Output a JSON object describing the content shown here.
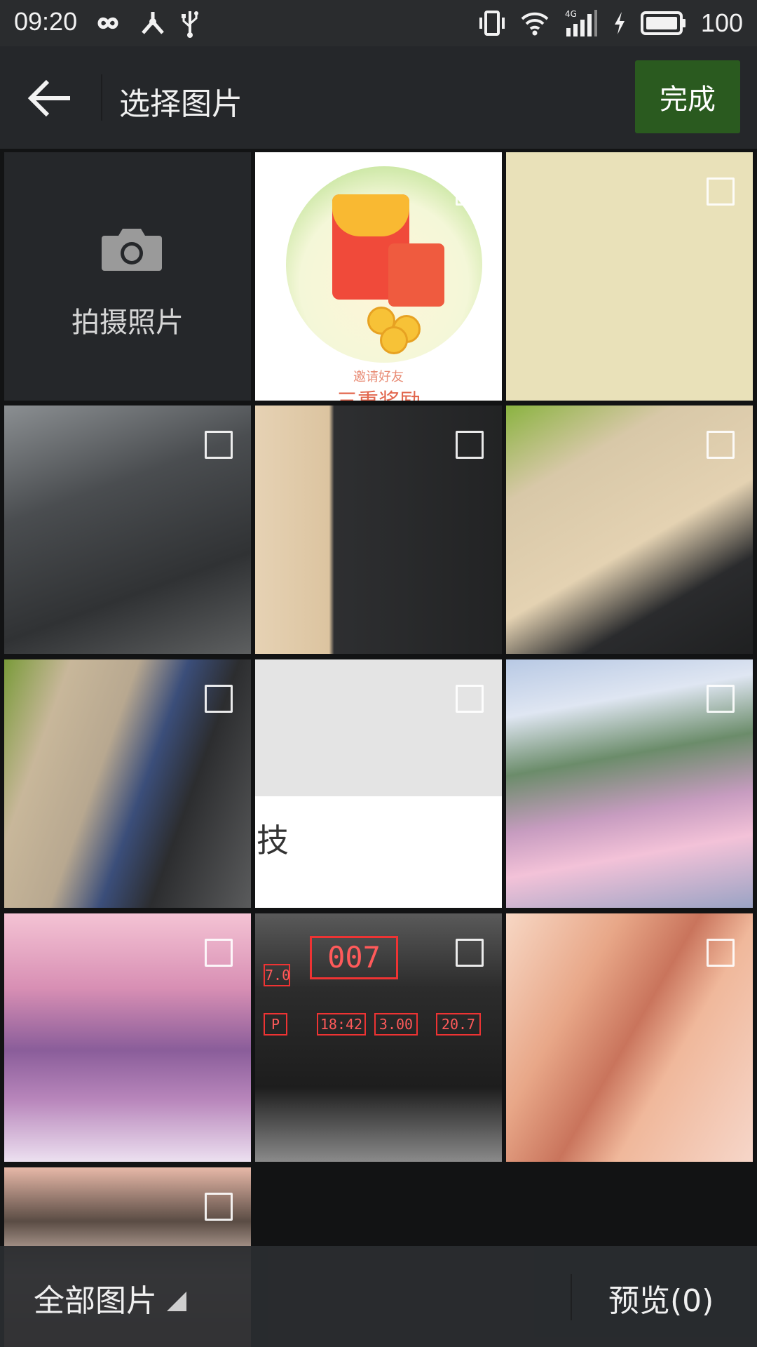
{
  "status_bar": {
    "time": "09:20",
    "battery": "100",
    "left_icons": [
      "infinity-icon",
      "share-node-icon",
      "usb-icon"
    ],
    "right_icons": [
      "vibrate-icon",
      "wifi-icon",
      "signal-4g-icon",
      "charging-icon",
      "battery-icon"
    ]
  },
  "app_bar": {
    "title": "选择图片",
    "done_label": "完成"
  },
  "grid": {
    "camera_label": "拍摄照片",
    "photos": [
      {
        "name": "red-packet-invite",
        "text_top": "邀请好友",
        "text_bottom": "三重奖励"
      },
      {
        "name": "beige-blank"
      },
      {
        "name": "keyboard-closeup"
      },
      {
        "name": "laptop-keyboard-desk"
      },
      {
        "name": "laptop-with-snacks"
      },
      {
        "name": "blurry-keyboard"
      },
      {
        "name": "white-screenshot",
        "text": "技"
      },
      {
        "name": "anime-railway-crossing"
      },
      {
        "name": "anime-cherry-blossoms"
      },
      {
        "name": "treadmill-display",
        "display": "007",
        "readouts": [
          "7.0",
          "P",
          "18:42",
          "3.00",
          "20.7"
        ]
      },
      {
        "name": "anime-couple"
      },
      {
        "name": "anime-portrait"
      }
    ]
  },
  "bottom_bar": {
    "album_label": "全部图片",
    "preview_label": "预览(0)"
  }
}
